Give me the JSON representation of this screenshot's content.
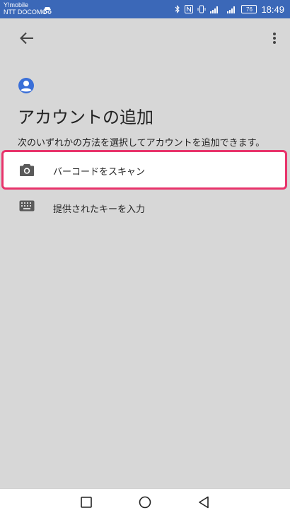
{
  "status_bar": {
    "carrier_line1": "Y!mobile",
    "carrier_line2": "NTT DOCOMO",
    "network": "4G",
    "battery": "76",
    "time": "18:49",
    "bg_color": "#3b68b8"
  },
  "toolbar": {
    "back_icon": "arrow-back-icon",
    "more_icon": "more-vert-icon"
  },
  "header": {
    "icon": "account-circle-icon",
    "title": "アカウントの追加",
    "subtitle": "次のいずれかの方法を選択してアカウントを追加できます。"
  },
  "options": [
    {
      "icon": "camera-icon",
      "label": "バーコードをスキャン",
      "highlighted": true
    },
    {
      "icon": "keyboard-icon",
      "label": "提供されたキーを入力",
      "highlighted": false
    }
  ],
  "nav_bar": {
    "recents_icon": "square-icon",
    "home_icon": "circle-icon",
    "back_icon": "triangle-back-icon"
  },
  "colors": {
    "accent": "#3a6fd8",
    "highlight_border": "#e8336b",
    "background": "#d7d7d7"
  }
}
